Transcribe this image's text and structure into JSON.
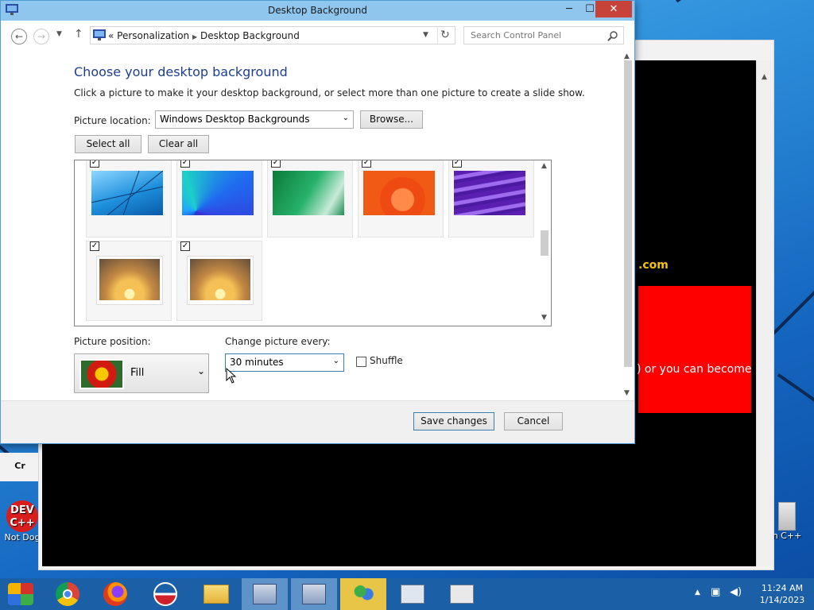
{
  "window": {
    "title": "Desktop Background"
  },
  "nav": {
    "address_prefix": "«",
    "breadcrumb": [
      "Personalization",
      "Desktop Background"
    ],
    "search_placeholder": "Search Control Panel"
  },
  "content": {
    "heading": "Choose your desktop background",
    "subtext": "Click a picture to make it your desktop background, or select more than one picture to create a slide show.",
    "picture_location_label": "Picture location:",
    "picture_location_value": "Windows Desktop Backgrounds",
    "browse_label": "Browse...",
    "select_all_label": "Select all",
    "clear_all_label": "Clear all",
    "picture_position_label": "Picture position:",
    "picture_position_value": "Fill",
    "change_every_label": "Change picture every:",
    "change_every_value": "30 minutes",
    "shuffle_label": "Shuffle",
    "shuffle_checked": false
  },
  "gallery": {
    "checkmark": "✓",
    "items": [
      {
        "name": "blue-lines",
        "checked": true
      },
      {
        "name": "blue-petals",
        "checked": true
      },
      {
        "name": "green-wave",
        "checked": true
      },
      {
        "name": "orange-swirl",
        "checked": true
      },
      {
        "name": "purple-waves",
        "checked": true
      },
      {
        "name": "sunset-tree-1",
        "checked": true
      },
      {
        "name": "sunset-tree-2",
        "checked": true
      }
    ]
  },
  "footer": {
    "save_label": "Save changes",
    "cancel_label": "Cancel"
  },
  "background_window": {
    "dotcom_text": ".com",
    "red_text": ") or you can become"
  },
  "desktop_icons": {
    "left_label_1": "Cr",
    "left_label_2": "Not Dog",
    "right_label": "n C++"
  },
  "taskbar": {
    "time": "11:24 AM",
    "date": "1/14/2023",
    "apps": [
      "start-icon",
      "chrome-icon",
      "firefox-icon",
      "obama-icon",
      "file-explorer-icon",
      "control-panel-icon",
      "network-icon",
      "people-icon",
      "performance-icon",
      "store-icon"
    ]
  },
  "colors": {
    "title_bar": "#8fc6ee",
    "heading": "#1d3d8f",
    "close_button": "#c7433a",
    "taskbar": "#1b5fa6"
  }
}
